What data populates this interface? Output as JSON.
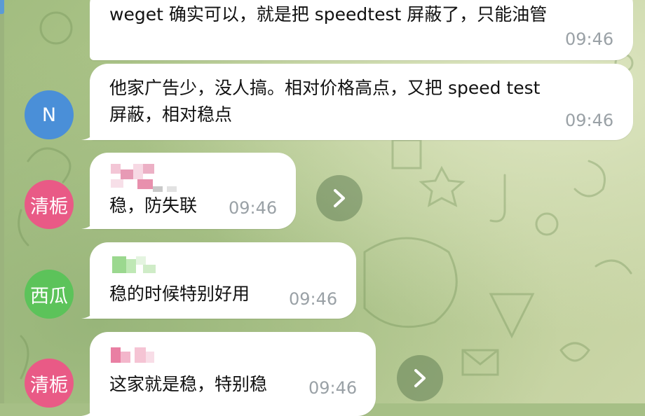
{
  "colors": {
    "bubble": "#ffffff",
    "timestamp": "#9aa1a6",
    "avatar_n": "#4a8fd8",
    "avatar_qingzhi": "#e95a86",
    "avatar_xigua": "#5cc35a",
    "wallpaper": "#b1c78c"
  },
  "messages": [
    {
      "text": "weget 确实可以，就是把 speedtest 屏蔽了，只能油管",
      "time": "09:46"
    },
    {
      "text_line1": "他家广告少，没人搞。相对价格高点，又把 speed test",
      "text_line2": "屏蔽，相对稳点",
      "time": "09:46",
      "avatar": "N"
    },
    {
      "text": "稳，防失联",
      "time": "09:46",
      "avatar": "清栀"
    },
    {
      "text": "稳的时候特别好用",
      "time": "09:46",
      "avatar": "西瓜"
    },
    {
      "text": "这家就是稳，特别稳",
      "time": "09:46",
      "avatar": "清栀"
    }
  ],
  "icons": {
    "forward": "forward-arrow-icon"
  }
}
